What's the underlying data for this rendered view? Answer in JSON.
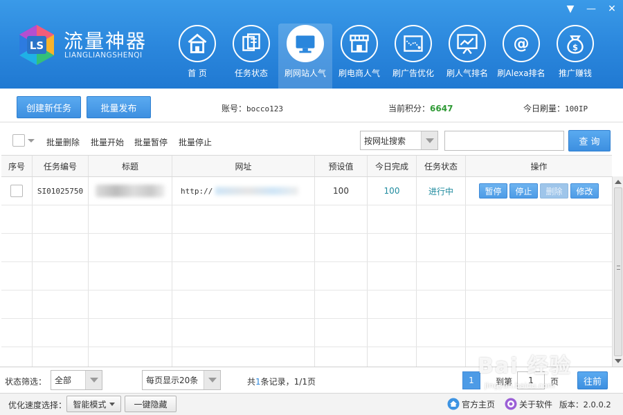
{
  "app": {
    "title": "流量神器",
    "subtitle": "LIANGLIANGSHENQI"
  },
  "nav": [
    {
      "label": "首 页",
      "icon": "home-icon"
    },
    {
      "label": "任务状态",
      "icon": "documents-icon"
    },
    {
      "label": "刷网站人气",
      "icon": "monitor-icon"
    },
    {
      "label": "刷电商人气",
      "icon": "store-icon"
    },
    {
      "label": "刷广告优化",
      "icon": "map-chart-icon"
    },
    {
      "label": "刷人气排名",
      "icon": "presentation-icon"
    },
    {
      "label": "刷Alexa排名",
      "icon": "at-icon"
    },
    {
      "label": "推广赚钱",
      "icon": "money-bag-icon"
    }
  ],
  "nav_active_index": 2,
  "toolbar": {
    "create_task": "创建新任务",
    "batch_publish": "批量发布",
    "account_label": "账号：",
    "account_value": "bocco123",
    "points_label": "当前积分：",
    "points_value": "6647",
    "today_label": "今日刷量：",
    "today_value": "100IP"
  },
  "batch": {
    "delete": "批量删除",
    "start": "批量开始",
    "pause": "批量暂停",
    "stop": "批量停止",
    "search_type": "按网址搜索",
    "search_value": "",
    "query": "查 询"
  },
  "table": {
    "headers": [
      "序号",
      "任务编号",
      "标题",
      "网址",
      "预设值",
      "今日完成",
      "任务状态",
      "操作"
    ],
    "rows": [
      {
        "task_id": "SI01025750",
        "title": "",
        "url": "http://",
        "preset": "100",
        "today_done": "100",
        "status": "进行中",
        "actions": [
          "暂停",
          "停止",
          "删除",
          "修改"
        ]
      }
    ]
  },
  "footer": {
    "filter_label": "状态筛选：",
    "filter_value": "全部",
    "page_size": "每页显示20条",
    "records_prefix": "共",
    "records_count": "1",
    "records_suffix": "条记录，1/1页",
    "current_page": "1",
    "goto_label": "到第",
    "goto_value": "1",
    "page_unit": "页",
    "go_button": "往前"
  },
  "statusbar": {
    "speed_label": "优化速度选择：",
    "speed_mode": "智能模式",
    "hide_button": "一键隐藏",
    "homepage": "官方主页",
    "about": "关于软件",
    "version": "版本：2.0.0.2"
  },
  "watermark": {
    "brand": "Bai 经验",
    "url": "jingyan.baidu.com"
  },
  "colors": {
    "header_blue": "#2a86dc",
    "button_blue": "#4d9be6",
    "points_green": "#2f9a35",
    "status_teal": "#1e8a9e"
  }
}
